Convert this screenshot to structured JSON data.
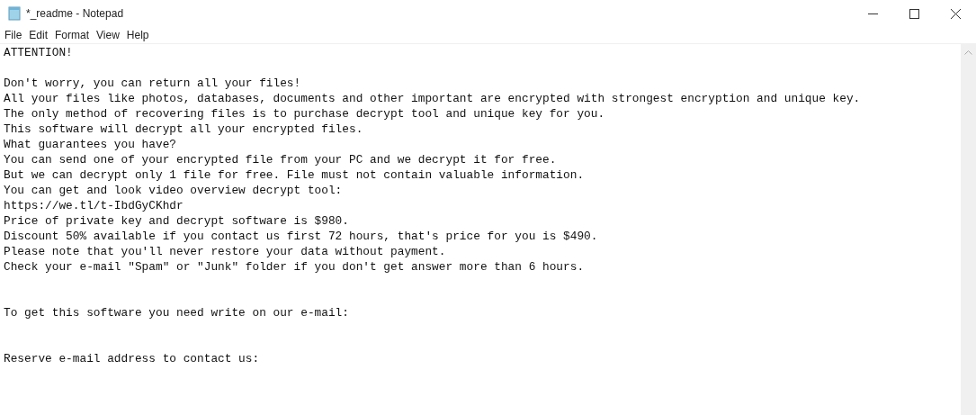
{
  "window": {
    "title": "*_readme - Notepad"
  },
  "menu": [
    "File",
    "Edit",
    "Format",
    "View",
    "Help"
  ],
  "document": {
    "lines": [
      {
        "kind": "text",
        "text": "ATTENTION!"
      },
      {
        "kind": "blank"
      },
      {
        "kind": "text",
        "text": "Don't worry, you can return all your files!"
      },
      {
        "kind": "text",
        "text": "All your files like photos, databases, documents and other important are encrypted with strongest encryption and unique key."
      },
      {
        "kind": "text",
        "text": "The only method of recovering files is to purchase decrypt tool and unique key for you."
      },
      {
        "kind": "text",
        "text": "This software will decrypt all your encrypted files."
      },
      {
        "kind": "text",
        "text": "What guarantees you have?"
      },
      {
        "kind": "text",
        "text": "You can send one of your encrypted file from your PC and we decrypt it for free."
      },
      {
        "kind": "text",
        "text": "But we can decrypt only 1 file for free. File must not contain valuable information."
      },
      {
        "kind": "text",
        "text": "You can get and look video overview decrypt tool:"
      },
      {
        "kind": "text",
        "text": "https://we.tl/t-IbdGyCKhdr"
      },
      {
        "kind": "text",
        "text": "Price of private key and decrypt software is $980."
      },
      {
        "kind": "text",
        "text": "Discount 50% available if you contact us first 72 hours, that's price for you is $490."
      },
      {
        "kind": "text",
        "text": "Please note that you'll never restore your data without payment."
      },
      {
        "kind": "text",
        "text": "Check your e-mail \"Spam\" or \"Junk\" folder if you don't get answer more than 6 hours."
      },
      {
        "kind": "blank"
      },
      {
        "kind": "blank"
      },
      {
        "kind": "text",
        "text": "To get this software you need write on our e-mail:"
      },
      {
        "kind": "blank"
      },
      {
        "kind": "blank"
      },
      {
        "kind": "text",
        "text": "Reserve e-mail address to contact us:"
      }
    ]
  }
}
